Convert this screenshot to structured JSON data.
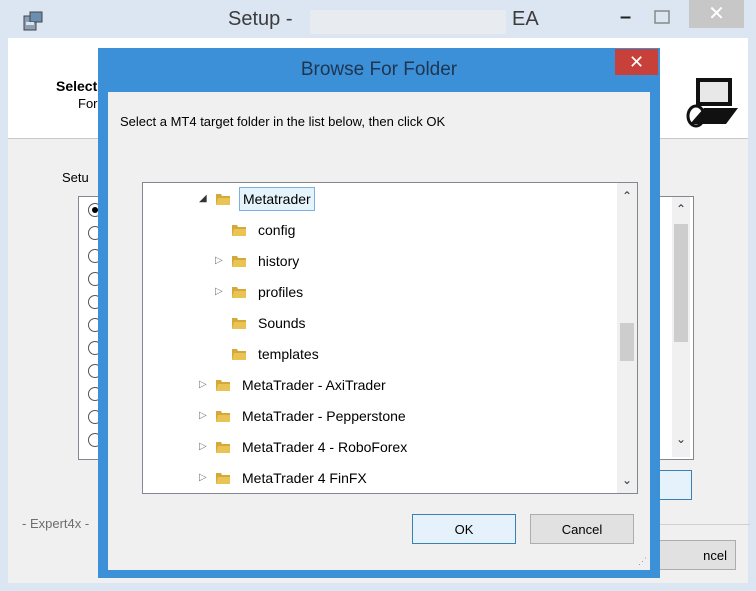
{
  "setup_window": {
    "title_prefix": "Setup -",
    "title_suffix": "EA",
    "header_title": "Select",
    "header_subtitle": "For v",
    "group_label": "Setu",
    "radio_count": 11,
    "brand_text": "- Expert4x -",
    "cancel_label": "ncel"
  },
  "browse_dialog": {
    "title": "Browse For Folder",
    "close_label": "✕",
    "prompt": "Select a MT4 target folder in the list below, then click OK",
    "ok_label": "OK",
    "cancel_label": "Cancel",
    "tree": [
      {
        "label": "Metatrader",
        "level": 0,
        "expander": "expanded",
        "selected": true
      },
      {
        "label": "config",
        "level": 1,
        "expander": "none",
        "selected": false
      },
      {
        "label": "history",
        "level": 1,
        "expander": "collapsed",
        "selected": false
      },
      {
        "label": "profiles",
        "level": 1,
        "expander": "collapsed",
        "selected": false
      },
      {
        "label": "Sounds",
        "level": 1,
        "expander": "none",
        "selected": false
      },
      {
        "label": "templates",
        "level": 1,
        "expander": "none",
        "selected": false
      },
      {
        "label": "MetaTrader - AxiTrader",
        "level": 0,
        "expander": "collapsed",
        "selected": false
      },
      {
        "label": "MetaTrader - Pepperstone",
        "level": 0,
        "expander": "collapsed",
        "selected": false
      },
      {
        "label": "MetaTrader 4 - RoboForex",
        "level": 0,
        "expander": "collapsed",
        "selected": false
      },
      {
        "label": "MetaTrader 4 FinFX",
        "level": 0,
        "expander": "collapsed",
        "selected": false
      }
    ]
  },
  "colors": {
    "dialog_frame": "#3c90d8",
    "close_red": "#c7413a",
    "folder_yellow": "#e9c454"
  }
}
